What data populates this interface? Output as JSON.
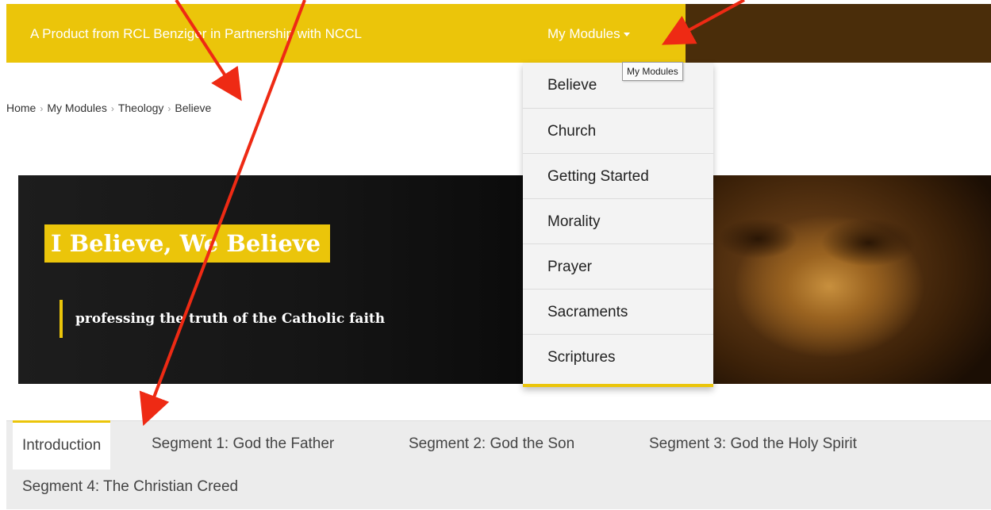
{
  "header": {
    "brand": "A Product from RCL Benziger in Partnership with NCCL",
    "modules_menu_label": "My Modules"
  },
  "breadcrumb": [
    "Home",
    "My Modules",
    "Theology",
    "Believe"
  ],
  "hero": {
    "title": "I Believe, We Believe",
    "subtitle": "professing the truth of the Catholic faith"
  },
  "tooltip": "My Modules",
  "dropdown": {
    "items": [
      "Believe",
      "Church",
      "Getting Started",
      "Morality",
      "Prayer",
      "Sacraments",
      "Scriptures"
    ]
  },
  "tabs": [
    "Introduction",
    "Segment 1: God the Father",
    "Segment 2: God the Son",
    "Segment 3: God the Holy Spirit",
    "Segment 4: The Christian Creed"
  ],
  "colors": {
    "brand_yellow": "#ebc50a",
    "dark_brown": "#4a2d0a",
    "arrow_red": "#ee2a14"
  }
}
